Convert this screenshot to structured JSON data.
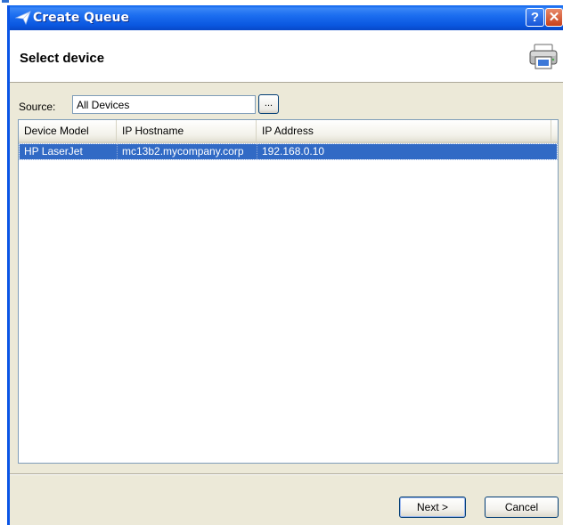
{
  "window": {
    "title": "Create Queue",
    "help_label": "?",
    "close_label": "✕"
  },
  "header": {
    "title": "Select device"
  },
  "source": {
    "label": "Source:",
    "value": "All Devices",
    "browse_label": "..."
  },
  "table": {
    "columns": [
      "Device Model",
      "IP Hostname",
      "IP Address"
    ],
    "rows": [
      {
        "device_model": "HP LaserJet",
        "ip_hostname": "mc13b2.mycompany.corp",
        "ip_address": "192.168.0.10",
        "selected": true
      }
    ]
  },
  "footer": {
    "next_label": "Next >",
    "cancel_label": "Cancel"
  },
  "icons": {
    "title": "send-arrow-icon",
    "header": "printer-icon"
  },
  "colors": {
    "titlebar": "#0a57e0",
    "selection": "#316ac5",
    "dialog_bg": "#ece9d8"
  }
}
